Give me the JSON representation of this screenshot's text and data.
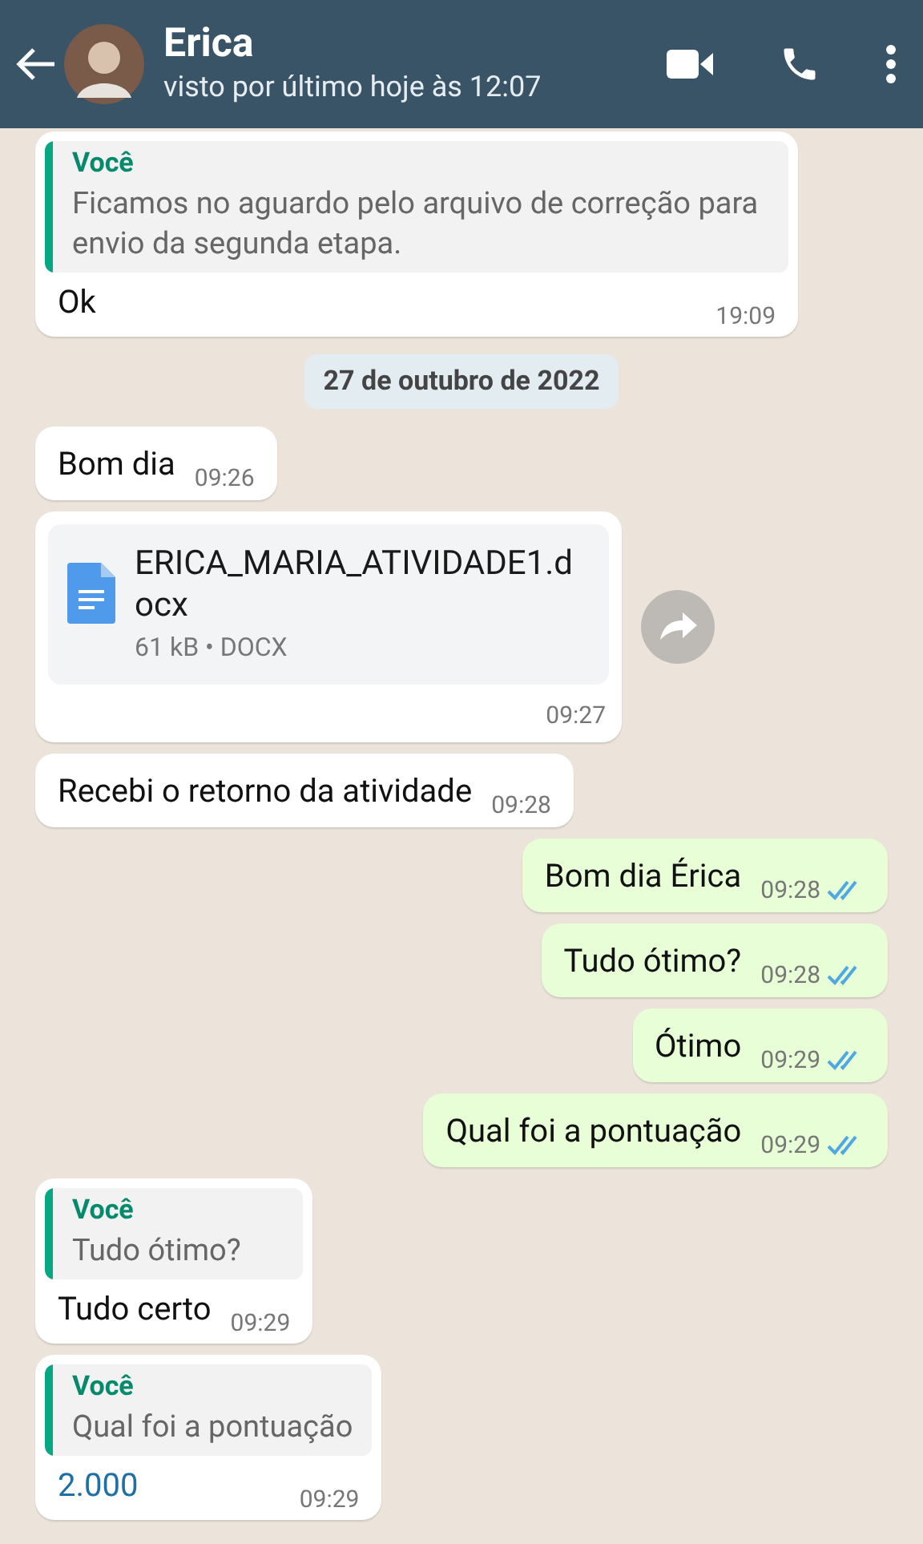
{
  "header": {
    "name": "Erica",
    "status": "visto por último hoje às 12:07"
  },
  "messages": [
    {
      "kind": "text",
      "outgoing": false,
      "quote": {
        "author": "Você",
        "text": "Ficamos no aguardo pelo arquivo de correção para envio da segunda etapa."
      },
      "text": "Ok",
      "time": "19:09"
    },
    {
      "kind": "date",
      "text": "27 de outubro de 2022"
    },
    {
      "kind": "text",
      "outgoing": false,
      "text": "Bom dia",
      "time": "09:26"
    },
    {
      "kind": "file",
      "outgoing": false,
      "file_name": "ERICA_MARIA_ATIVIDADE1.docx",
      "file_meta": "61 kB • DOCX",
      "time": "09:27"
    },
    {
      "kind": "text",
      "outgoing": false,
      "text": "Recebi o retorno da atividade",
      "time": "09:28"
    },
    {
      "kind": "text",
      "outgoing": true,
      "text": "Bom dia Érica",
      "time": "09:28",
      "read": true
    },
    {
      "kind": "text",
      "outgoing": true,
      "text": "Tudo ótimo?",
      "time": "09:28",
      "read": true
    },
    {
      "kind": "text",
      "outgoing": true,
      "text": "Ótimo",
      "time": "09:29",
      "read": true
    },
    {
      "kind": "text",
      "outgoing": true,
      "text": "Qual foi a pontuação",
      "time": "09:29",
      "read": true
    },
    {
      "kind": "text",
      "outgoing": false,
      "quote": {
        "author": "Você",
        "text": "Tudo ótimo?"
      },
      "text": "Tudo certo",
      "time": "09:29"
    },
    {
      "kind": "text",
      "outgoing": false,
      "quote": {
        "author": "Você",
        "text": "Qual foi a pontuação"
      },
      "text": "2.000",
      "time": "09:29",
      "link": true
    }
  ]
}
